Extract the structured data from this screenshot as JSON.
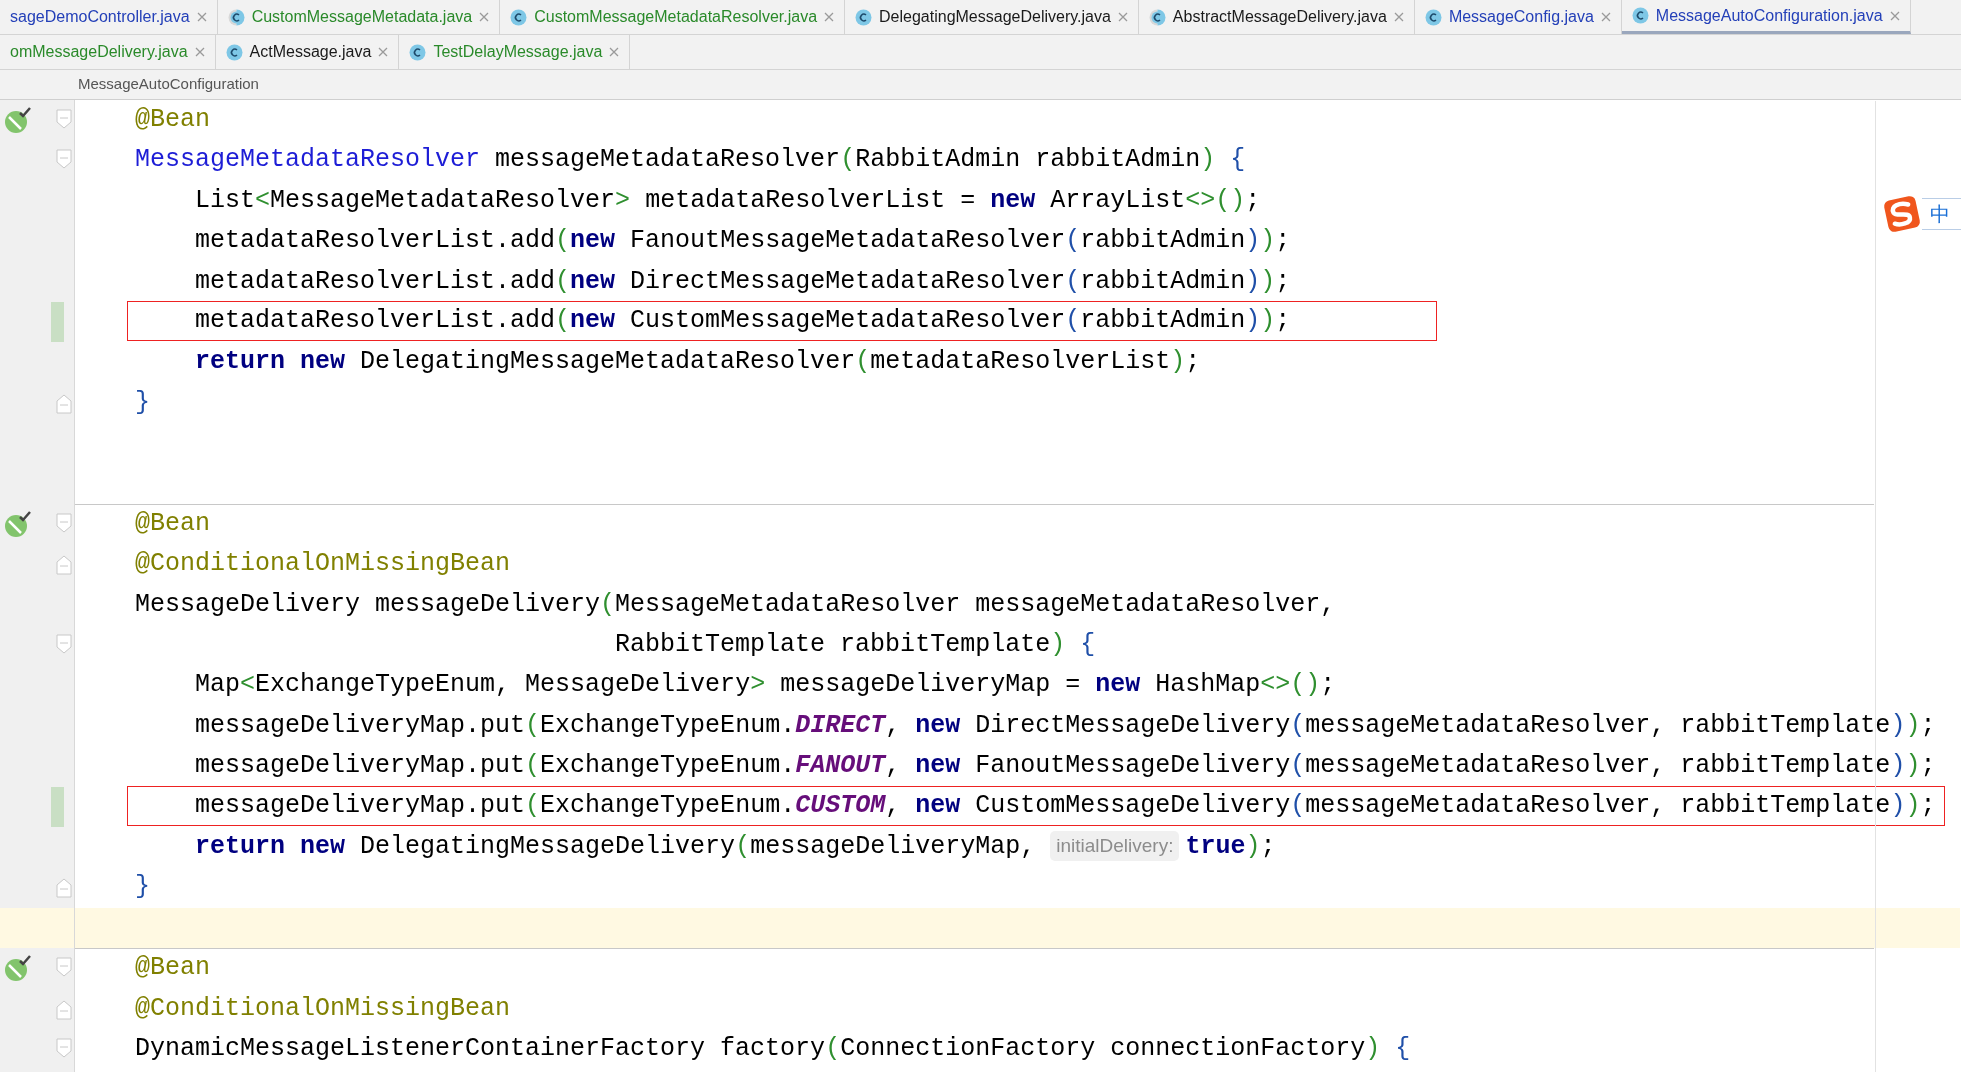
{
  "tab_rows": [
    [
      {
        "label": "sageDemoController.java",
        "color": "#2440b8",
        "kind": "plain",
        "selected": false
      },
      {
        "label": "CustomMessageMetadata.java",
        "color": "#2a8a2a",
        "kind": "abstract-class",
        "selected": false
      },
      {
        "label": "CustomMessageMetadataResolver.java",
        "color": "#2a8a2a",
        "kind": "class",
        "selected": false
      },
      {
        "label": "DelegatingMessageDelivery.java",
        "color": "#1a1a1a",
        "kind": "class",
        "selected": false
      },
      {
        "label": "AbstractMessageDelivery.java",
        "color": "#1a1a1a",
        "kind": "abstract-class",
        "selected": false
      },
      {
        "label": "MessageConfig.java",
        "color": "#2440b8",
        "kind": "class",
        "selected": false
      },
      {
        "label": "MessageAutoConfiguration.java",
        "color": "#2440b8",
        "kind": "class",
        "selected": true
      }
    ],
    [
      {
        "label": "omMessageDelivery.java",
        "color": "#2a8a2a",
        "kind": "plain",
        "selected": false
      },
      {
        "label": "ActMessage.java",
        "color": "#1a1a1a",
        "kind": "class",
        "selected": false
      },
      {
        "label": "TestDelayMessage.java",
        "color": "#2a8a2a",
        "kind": "class",
        "selected": false
      }
    ]
  ],
  "breadcrumb": "MessageAutoConfiguration",
  "lines": [
    {
      "kind": "code",
      "bean_marker": true,
      "fold_start": true,
      "tokens": [
        {
          "kind": "annotation",
          "text": "@Bean"
        }
      ]
    },
    {
      "kind": "code",
      "fold_start": true,
      "tokens": [
        {
          "kind": "type",
          "text": "MessageMetadataResolver"
        },
        {
          "kind": "plain",
          "text": " messageMetadataResolver"
        },
        {
          "kind": "bracket",
          "text": "("
        },
        {
          "kind": "plain",
          "text": "RabbitAdmin rabbitAdmin"
        },
        {
          "kind": "bracket",
          "text": ")"
        },
        {
          "kind": "brace",
          "text": " {"
        }
      ]
    },
    {
      "kind": "code",
      "tokens": [
        {
          "kind": "plain",
          "text": "    List"
        },
        {
          "kind": "bracket",
          "text": "<"
        },
        {
          "kind": "plain",
          "text": "MessageMetadataResolver"
        },
        {
          "kind": "bracket",
          "text": ">"
        },
        {
          "kind": "plain",
          "text": " metadataResolverList = "
        },
        {
          "kind": "keyword",
          "text": "new"
        },
        {
          "kind": "plain",
          "text": " ArrayList"
        },
        {
          "kind": "bracket",
          "text": "<>()"
        },
        {
          "kind": "plain",
          "text": ";"
        }
      ]
    },
    {
      "kind": "code",
      "tokens": [
        {
          "kind": "plain",
          "text": "    metadataResolverList.add"
        },
        {
          "kind": "bracket",
          "text": "("
        },
        {
          "kind": "keyword",
          "text": "new"
        },
        {
          "kind": "plain",
          "text": " FanoutMessageMetadataResolver"
        },
        {
          "kind": "brace",
          "text": "("
        },
        {
          "kind": "plain",
          "text": "rabbitAdmin"
        },
        {
          "kind": "brace",
          "text": ")"
        },
        {
          "kind": "bracket",
          "text": ")"
        },
        {
          "kind": "plain",
          "text": ";"
        }
      ]
    },
    {
      "kind": "code",
      "tokens": [
        {
          "kind": "plain",
          "text": "    metadataResolverList.add"
        },
        {
          "kind": "bracket",
          "text": "("
        },
        {
          "kind": "keyword",
          "text": "new"
        },
        {
          "kind": "plain",
          "text": " DirectMessageMetadataResolver"
        },
        {
          "kind": "brace",
          "text": "("
        },
        {
          "kind": "plain",
          "text": "rabbitAdmin"
        },
        {
          "kind": "brace",
          "text": ")"
        },
        {
          "kind": "bracket",
          "text": ")"
        },
        {
          "kind": "plain",
          "text": ";"
        }
      ]
    },
    {
      "kind": "code",
      "changed": true,
      "tokens": [
        {
          "kind": "plain",
          "text": "    metadataResolverList.add"
        },
        {
          "kind": "bracket",
          "text": "("
        },
        {
          "kind": "keyword",
          "text": "new"
        },
        {
          "kind": "plain",
          "text": " CustomMessageMetadataResolver"
        },
        {
          "kind": "brace",
          "text": "("
        },
        {
          "kind": "plain",
          "text": "rabbitAdmin"
        },
        {
          "kind": "brace",
          "text": ")"
        },
        {
          "kind": "bracket",
          "text": ")"
        },
        {
          "kind": "plain",
          "text": ";"
        }
      ]
    },
    {
      "kind": "code",
      "tokens": [
        {
          "kind": "keyword",
          "text": "    return new"
        },
        {
          "kind": "plain",
          "text": " DelegatingMessageMetadataResolver"
        },
        {
          "kind": "bracket",
          "text": "("
        },
        {
          "kind": "plain",
          "text": "metadataResolverList"
        },
        {
          "kind": "bracket",
          "text": ")"
        },
        {
          "kind": "plain",
          "text": ";"
        }
      ]
    },
    {
      "kind": "code",
      "fold_end": true,
      "tokens": [
        {
          "kind": "brace",
          "text": "}"
        }
      ]
    },
    {
      "kind": "blank"
    },
    {
      "kind": "blank"
    },
    {
      "kind": "code",
      "separator": true,
      "bean_marker": true,
      "fold_start": true,
      "tokens": [
        {
          "kind": "annotation",
          "text": "@Bean"
        }
      ]
    },
    {
      "kind": "code",
      "fold_end": true,
      "tokens": [
        {
          "kind": "annotation",
          "text": "@ConditionalOnMissingBean"
        }
      ]
    },
    {
      "kind": "code",
      "tokens": [
        {
          "kind": "plain",
          "text": "MessageDelivery messageDelivery"
        },
        {
          "kind": "bracket",
          "text": "("
        },
        {
          "kind": "plain",
          "text": "MessageMetadataResolver messageMetadataResolver,"
        }
      ]
    },
    {
      "kind": "code",
      "fold_start": true,
      "tokens": [
        {
          "kind": "plain",
          "text": "                                RabbitTemplate rabbitTemplate"
        },
        {
          "kind": "bracket",
          "text": ")"
        },
        {
          "kind": "brace",
          "text": " {"
        }
      ]
    },
    {
      "kind": "code",
      "tokens": [
        {
          "kind": "plain",
          "text": "    Map"
        },
        {
          "kind": "bracket",
          "text": "<"
        },
        {
          "kind": "plain",
          "text": "ExchangeTypeEnum, MessageDelivery"
        },
        {
          "kind": "bracket",
          "text": ">"
        },
        {
          "kind": "plain",
          "text": " messageDeliveryMap = "
        },
        {
          "kind": "keyword",
          "text": "new"
        },
        {
          "kind": "plain",
          "text": " HashMap"
        },
        {
          "kind": "bracket",
          "text": "<>()"
        },
        {
          "kind": "plain",
          "text": ";"
        }
      ]
    },
    {
      "kind": "code",
      "tokens": [
        {
          "kind": "plain",
          "text": "    messageDeliveryMap.put"
        },
        {
          "kind": "bracket",
          "text": "("
        },
        {
          "kind": "plain",
          "text": "ExchangeTypeEnum."
        },
        {
          "kind": "constant",
          "text": "DIRECT"
        },
        {
          "kind": "plain",
          "text": ", "
        },
        {
          "kind": "keyword",
          "text": "new"
        },
        {
          "kind": "plain",
          "text": " DirectMessageDelivery"
        },
        {
          "kind": "brace",
          "text": "("
        },
        {
          "kind": "plain",
          "text": "messageMetadataResolver, rabbitTemplate"
        },
        {
          "kind": "brace",
          "text": ")"
        },
        {
          "kind": "bracket",
          "text": ")"
        },
        {
          "kind": "plain",
          "text": ";"
        }
      ]
    },
    {
      "kind": "code",
      "tokens": [
        {
          "kind": "plain",
          "text": "    messageDeliveryMap.put"
        },
        {
          "kind": "bracket",
          "text": "("
        },
        {
          "kind": "plain",
          "text": "ExchangeTypeEnum."
        },
        {
          "kind": "constant",
          "text": "FANOUT"
        },
        {
          "kind": "plain",
          "text": ", "
        },
        {
          "kind": "keyword",
          "text": "new"
        },
        {
          "kind": "plain",
          "text": " FanoutMessageDelivery"
        },
        {
          "kind": "brace",
          "text": "("
        },
        {
          "kind": "plain",
          "text": "messageMetadataResolver, rabbitTemplate"
        },
        {
          "kind": "brace",
          "text": ")"
        },
        {
          "kind": "bracket",
          "text": ")"
        },
        {
          "kind": "plain",
          "text": ";"
        }
      ]
    },
    {
      "kind": "code",
      "changed": true,
      "tokens": [
        {
          "kind": "plain",
          "text": "    messageDeliveryMap.put"
        },
        {
          "kind": "bracket",
          "text": "("
        },
        {
          "kind": "plain",
          "text": "ExchangeTypeEnum."
        },
        {
          "kind": "constant",
          "text": "CUSTOM"
        },
        {
          "kind": "plain",
          "text": ", "
        },
        {
          "kind": "keyword",
          "text": "new"
        },
        {
          "kind": "plain",
          "text": " CustomMessageDelivery"
        },
        {
          "kind": "brace",
          "text": "("
        },
        {
          "kind": "plain",
          "text": "messageMetadataResolver, rabbitTemplate"
        },
        {
          "kind": "brace",
          "text": ")"
        },
        {
          "kind": "bracket",
          "text": ")"
        },
        {
          "kind": "plain",
          "text": ";"
        }
      ]
    },
    {
      "kind": "code",
      "tokens": [
        {
          "kind": "keyword",
          "text": "    return new"
        },
        {
          "kind": "plain",
          "text": " DelegatingMessageDelivery"
        },
        {
          "kind": "bracket",
          "text": "("
        },
        {
          "kind": "plain",
          "text": "messageDeliveryMap, "
        },
        {
          "kind": "hint",
          "text": "initialDelivery:"
        },
        {
          "kind": "keyword",
          "text": "true"
        },
        {
          "kind": "bracket",
          "text": ")"
        },
        {
          "kind": "plain",
          "text": ";"
        }
      ]
    },
    {
      "kind": "code",
      "fold_end": true,
      "tokens": [
        {
          "kind": "brace",
          "text": "}"
        }
      ]
    },
    {
      "kind": "blank",
      "current": true
    },
    {
      "kind": "code",
      "separator": true,
      "bean_marker": true,
      "fold_start": true,
      "tokens": [
        {
          "kind": "annotation",
          "text": "@Bean"
        }
      ]
    },
    {
      "kind": "code",
      "fold_end": true,
      "tokens": [
        {
          "kind": "annotation",
          "text": "@ConditionalOnMissingBean"
        }
      ]
    },
    {
      "kind": "code",
      "fold_start": true,
      "tokens": [
        {
          "kind": "plain",
          "text": "DynamicMessageListenerContainerFactory factory"
        },
        {
          "kind": "bracket",
          "text": "("
        },
        {
          "kind": "plain",
          "text": "ConnectionFactory connectionFactory"
        },
        {
          "kind": "bracket",
          "text": ")"
        },
        {
          "kind": "brace",
          "text": " {"
        }
      ]
    }
  ],
  "ime": {
    "mode": "中"
  }
}
